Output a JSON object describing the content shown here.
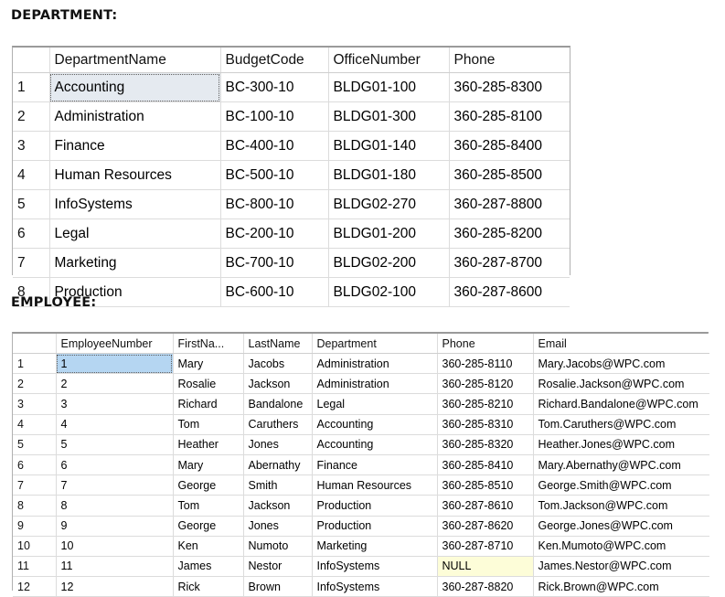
{
  "department_section": {
    "caption": "DEPARTMENT:",
    "columns": [
      "",
      "DepartmentName",
      "BudgetCode",
      "OfficeNumber",
      "Phone"
    ],
    "rows": [
      {
        "num": "1",
        "DepartmentName": "Accounting",
        "BudgetCode": "BC-300-10",
        "OfficeNumber": "BLDG01-100",
        "Phone": "360-285-8300"
      },
      {
        "num": "2",
        "DepartmentName": "Administration",
        "BudgetCode": "BC-100-10",
        "OfficeNumber": "BLDG01-300",
        "Phone": "360-285-8100"
      },
      {
        "num": "3",
        "DepartmentName": "Finance",
        "BudgetCode": "BC-400-10",
        "OfficeNumber": "BLDG01-140",
        "Phone": "360-285-8400"
      },
      {
        "num": "4",
        "DepartmentName": "Human Resources",
        "BudgetCode": "BC-500-10",
        "OfficeNumber": "BLDG01-180",
        "Phone": "360-285-8500"
      },
      {
        "num": "5",
        "DepartmentName": "InfoSystems",
        "BudgetCode": "BC-800-10",
        "OfficeNumber": "BLDG02-270",
        "Phone": "360-287-8800"
      },
      {
        "num": "6",
        "DepartmentName": "Legal",
        "BudgetCode": "BC-200-10",
        "OfficeNumber": "BLDG01-200",
        "Phone": "360-285-8200"
      },
      {
        "num": "7",
        "DepartmentName": "Marketing",
        "BudgetCode": "BC-700-10",
        "OfficeNumber": "BLDG02-200",
        "Phone": "360-287-8700"
      },
      {
        "num": "8",
        "DepartmentName": "Production",
        "BudgetCode": "BC-600-10",
        "OfficeNumber": "BLDG02-100",
        "Phone": "360-287-8600"
      }
    ],
    "selected_cell": {
      "row": 0,
      "column": "DepartmentName",
      "value": "Accounting"
    }
  },
  "employee_section": {
    "caption": "EMPLOYEE:",
    "columns": [
      "",
      "EmployeeNumber",
      "FirstNa...",
      "LastName",
      "Department",
      "Phone",
      "Email"
    ],
    "rows": [
      {
        "num": "1",
        "EmployeeNumber": "1",
        "FirstName": "Mary",
        "LastName": "Jacobs",
        "Department": "Administration",
        "Phone": "360-285-8110",
        "Email": "Mary.Jacobs@WPC.com"
      },
      {
        "num": "2",
        "EmployeeNumber": "2",
        "FirstName": "Rosalie",
        "LastName": "Jackson",
        "Department": "Administration",
        "Phone": "360-285-8120",
        "Email": "Rosalie.Jackson@WPC.com"
      },
      {
        "num": "3",
        "EmployeeNumber": "3",
        "FirstName": "Richard",
        "LastName": "Bandalone",
        "Department": "Legal",
        "Phone": "360-285-8210",
        "Email": "Richard.Bandalone@WPC.com"
      },
      {
        "num": "4",
        "EmployeeNumber": "4",
        "FirstName": "Tom",
        "LastName": "Caruthers",
        "Department": "Accounting",
        "Phone": "360-285-8310",
        "Email": "Tom.Caruthers@WPC.com"
      },
      {
        "num": "5",
        "EmployeeNumber": "5",
        "FirstName": "Heather",
        "LastName": "Jones",
        "Department": "Accounting",
        "Phone": "360-285-8320",
        "Email": "Heather.Jones@WPC.com"
      },
      {
        "num": "6",
        "EmployeeNumber": "6",
        "FirstName": "Mary",
        "LastName": "Abernathy",
        "Department": "Finance",
        "Phone": "360-285-8410",
        "Email": "Mary.Abernathy@WPC.com"
      },
      {
        "num": "7",
        "EmployeeNumber": "7",
        "FirstName": "George",
        "LastName": "Smith",
        "Department": "Human Resources",
        "Phone": "360-285-8510",
        "Email": "George.Smith@WPC.com"
      },
      {
        "num": "8",
        "EmployeeNumber": "8",
        "FirstName": "Tom",
        "LastName": "Jackson",
        "Department": "Production",
        "Phone": "360-287-8610",
        "Email": "Tom.Jackson@WPC.com"
      },
      {
        "num": "9",
        "EmployeeNumber": "9",
        "FirstName": "George",
        "LastName": "Jones",
        "Department": "Production",
        "Phone": "360-287-8620",
        "Email": "George.Jones@WPC.com"
      },
      {
        "num": "10",
        "EmployeeNumber": "10",
        "FirstName": "Ken",
        "LastName": "Numoto",
        "Department": "Marketing",
        "Phone": "360-287-8710",
        "Email": "Ken.Mumoto@WPC.com"
      },
      {
        "num": "11",
        "EmployeeNumber": "11",
        "FirstName": "James",
        "LastName": "Nestor",
        "Department": "InfoSystems",
        "Phone": "NULL",
        "Email": "James.Nestor@WPC.com"
      },
      {
        "num": "12",
        "EmployeeNumber": "12",
        "FirstName": "Rick",
        "LastName": "Brown",
        "Department": "InfoSystems",
        "Phone": "360-287-8820",
        "Email": "Rick.Brown@WPC.com"
      }
    ],
    "selected_cell": {
      "row": 0,
      "column": "EmployeeNumber",
      "value": "1"
    },
    "null_cells": [
      {
        "row": 10,
        "column": "Phone",
        "value": "NULL"
      }
    ]
  },
  "colors": {
    "selected_grey": "#e5eaf0",
    "selected_blue": "#b5d6f2",
    "null_background": "#fdfdd8",
    "grid_line": "#dcdcdc",
    "grid_border": "#b0b0b0"
  }
}
